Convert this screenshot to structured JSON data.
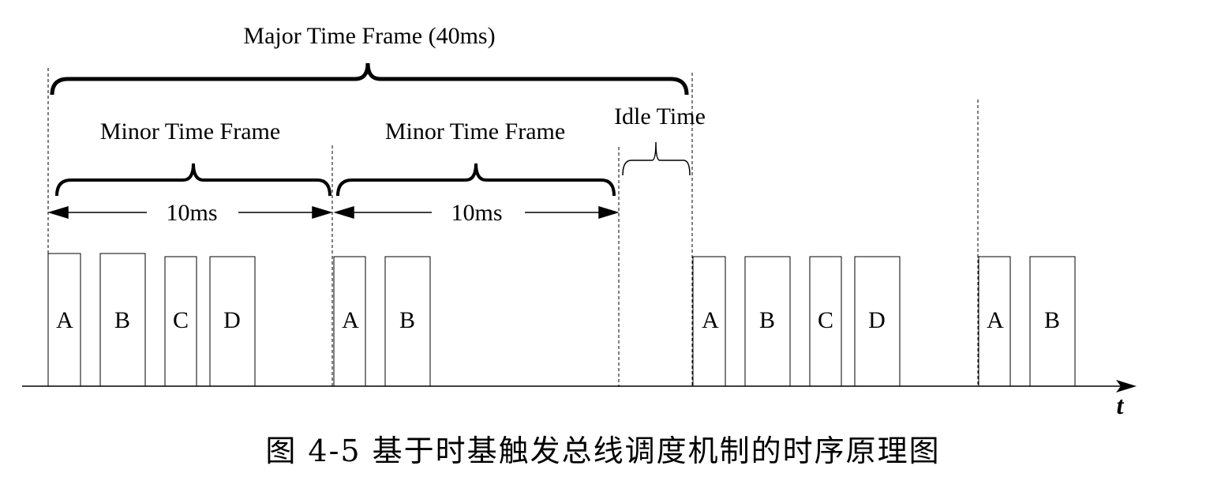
{
  "labels": {
    "major_frame": "Major  Time Frame (40ms)",
    "minor_frame_1": "Minor  Time Frame",
    "minor_frame_2": "Minor  Time Frame",
    "idle_time": "Idle Time",
    "duration_1": "10ms",
    "duration_2": "10ms",
    "axis_t": "t"
  },
  "slots": {
    "g1": [
      "A",
      "B",
      "C",
      "D"
    ],
    "g2": [
      "A",
      "B"
    ],
    "g3": [
      "A",
      "B",
      "C",
      "D"
    ],
    "g4": [
      "A",
      "B"
    ]
  },
  "caption": "图 4-5  基于时基触发总线调度机制的时序原理图"
}
